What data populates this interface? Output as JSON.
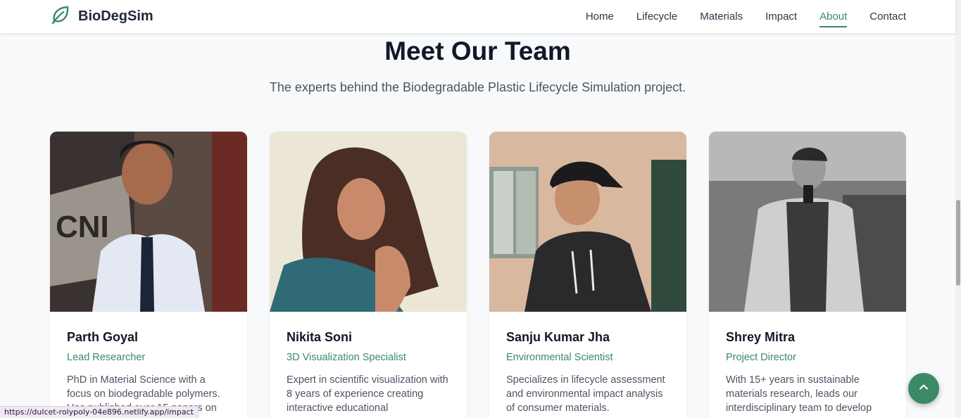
{
  "brand": {
    "name": "BioDegSim",
    "icon": "leaf-icon",
    "accent": "#3a8a66"
  },
  "nav": {
    "links": [
      {
        "label": "Home"
      },
      {
        "label": "Lifecycle"
      },
      {
        "label": "Materials"
      },
      {
        "label": "Impact"
      },
      {
        "label": "About"
      },
      {
        "label": "Contact"
      }
    ],
    "active": "About"
  },
  "section": {
    "title": "Meet Our Team",
    "subtitle": "The experts behind the Biodegradable Plastic Lifecycle Simulation project."
  },
  "team": [
    {
      "name": "Parth Goyal",
      "role": "Lead Researcher",
      "bio": "PhD in Material Science with a focus on biodegradable polymers. Has published over 15 papers on"
    },
    {
      "name": "Nikita Soni",
      "role": "3D Visualization Specialist",
      "bio": "Expert in scientific visualization with 8 years of experience creating interactive educational"
    },
    {
      "name": "Sanju Kumar Jha",
      "role": "Environmental Scientist",
      "bio": "Specializes in lifecycle assessment and environmental impact analysis of consumer materials."
    },
    {
      "name": "Shrey Mitra",
      "role": "Project Director",
      "bio": "With 15+ years in sustainable materials research, leads our interdisciplinary team to develop"
    }
  ],
  "back_to_top": {
    "icon": "chevron-up-icon"
  },
  "status_bar": {
    "url": "https://dulcet-rolypoly-04e896.netlify.app/impact"
  }
}
